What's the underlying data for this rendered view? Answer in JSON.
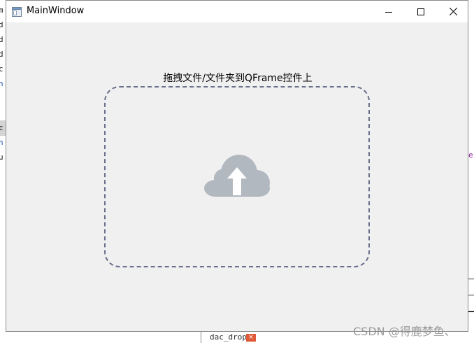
{
  "window": {
    "title": "MainWindow",
    "controls": {
      "minimize_icon": "minimize-icon",
      "maximize_icon": "maximize-icon",
      "close_icon": "close-icon"
    }
  },
  "drop_area": {
    "label": "拖拽文件/文件夹到QFrame控件上",
    "icon": "cloud-upload-icon",
    "border_color": "#6a6f8c",
    "icon_color": "#b2b8bf"
  },
  "background": {
    "left_fragments": [
      "m",
      "d",
      "d",
      "d",
      "c",
      "h",
      "c",
      "h",
      "u"
    ],
    "right_fragment": "e",
    "bottom_tab": {
      "label": "dac_drop",
      "close_glyph": "×"
    }
  },
  "watermark": "CSDN @得鹿梦鱼、"
}
